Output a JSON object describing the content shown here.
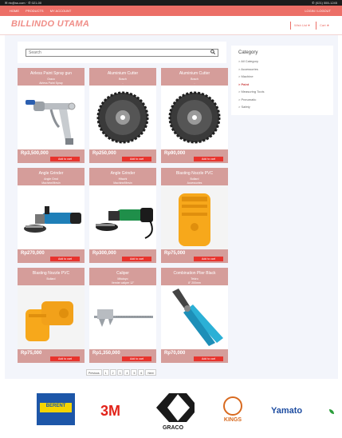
{
  "topbar": {
    "left_text": "✉ rtx@ss.com · ✆ 021-00",
    "right_text": "✆ (021) 555-1245"
  },
  "nav": {
    "links": [
      "HOME",
      "PRODUCTS",
      "MY ACCOUNT"
    ],
    "logout": "LOGIN / LOGOUT"
  },
  "header": {
    "brand": "BILLINDO UTAMA",
    "wishlist": "Wish List ♥",
    "cart": "Cart ★"
  },
  "search": {
    "placeholder": "Search",
    "icon": "search-icon"
  },
  "category": {
    "title": "Category",
    "items": [
      "> All Category",
      "> Accessories",
      "> Machine",
      "> Paint",
      "> Measuring Tools",
      "> Pneumatic",
      "> Safety"
    ]
  },
  "products": [
    {
      "name": "Airless Paint Spray gun",
      "brand": "Graco",
      "type": "Airless Paint Spray",
      "price": "Rp3,500,000",
      "add": "Add to cart",
      "img": "spraygun"
    },
    {
      "name": "Aluminium Cutter",
      "brand": "Bosch",
      "type": "-",
      "price": "Rp250,000",
      "add": "Add to cart",
      "img": "saw"
    },
    {
      "name": "Aluminium Cutter",
      "brand": "Bosch",
      "type": "-",
      "price": "Rp90,000",
      "add": "Add to cart",
      "img": "saw"
    },
    {
      "name": "Angle Grinder",
      "brand": "Angle Grnd",
      "type": "Machine/Mesin",
      "price": "Rp270,000",
      "add": "Add to cart",
      "img": "grinder-blue"
    },
    {
      "name": "Angle Grinder",
      "brand": "Hitachi",
      "type": "Machine/Mesin",
      "price": "Rp300,000",
      "add": "Add to cart",
      "img": "grinder-green"
    },
    {
      "name": "Blasting Nozzle PVC",
      "brand": "Bullard",
      "type": "Accessories",
      "price": "Rp75,000",
      "add": "Add to cart",
      "img": "nozzle"
    },
    {
      "name": "Blasting Nozzle PVC",
      "brand": "Bullard",
      "type": "",
      "price": "Rp75,000",
      "add": "Add to cart",
      "img": "nozzle2"
    },
    {
      "name": "Caliper",
      "brand": "Mitutoyo",
      "type": "Vernier caliper 12\"",
      "price": "Rp1,350,000",
      "add": "Add to cart",
      "img": "caliper"
    },
    {
      "name": "Combination Plier Black",
      "brand": "Tekiro",
      "type": "8\" 200mm",
      "price": "Rp70,000",
      "add": "Add to cart",
      "img": "plier"
    }
  ],
  "pagination": [
    "Previous",
    "1",
    "2",
    "3",
    "4",
    "5",
    "6",
    "Next"
  ],
  "brands": [
    {
      "name": "BERENT",
      "color": "#1d56a8"
    },
    {
      "name": "3M",
      "color": "#e2231a"
    },
    {
      "name": "GRACO",
      "color": "#1a1a1a"
    },
    {
      "name": "KINGS",
      "color": "#d86a1f"
    },
    {
      "name": "Yamato",
      "color": "#1e4da1"
    }
  ]
}
